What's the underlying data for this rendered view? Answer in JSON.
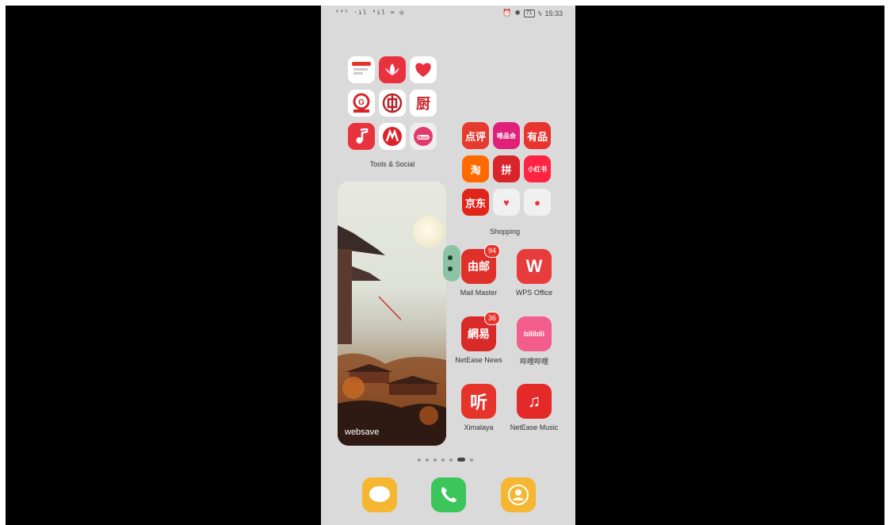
{
  "status": {
    "left_text": "⁰⁰ᴳ ·ıl ⁴ıl ≈ ◎",
    "battery": "71",
    "time": "15:33"
  },
  "folders": {
    "tools_social": {
      "label": "Tools & Social",
      "icons": [
        "notes-icon",
        "lotus-icon",
        "heart-app-icon",
        "bank-icon",
        "bank-of-china-icon",
        "kitchen-app-icon",
        "music-note-icon",
        "metro-icon",
        "music-player-icon"
      ]
    },
    "shopping": {
      "label": "Shopping",
      "icons": [
        {
          "name": "dianping-icon",
          "text": "点评"
        },
        {
          "name": "vip-shop-icon",
          "text": "唯品会"
        },
        {
          "name": "youpin-icon",
          "text": "有品"
        },
        {
          "name": "taobao-icon",
          "text": "淘"
        },
        {
          "name": "pinduoduo-icon",
          "text": "拼"
        },
        {
          "name": "xiaohongshu-icon",
          "text": "小红书"
        },
        {
          "name": "jd-icon",
          "text": "京东"
        },
        {
          "name": "heart-shop-icon",
          "text": "♥"
        },
        {
          "name": "pet-app-icon",
          "text": "●"
        }
      ]
    }
  },
  "widget": {
    "label": "websave"
  },
  "apps": [
    {
      "id": "mail-master",
      "label": "Mail Master",
      "glyph": "由邮",
      "badge": "94",
      "color": "#e0302a"
    },
    {
      "id": "wps-office",
      "label": "WPS Office",
      "glyph": "W",
      "badge": "",
      "color": "#e83b3b"
    },
    {
      "id": "netease-news",
      "label": "NetEase News",
      "glyph": "網易",
      "badge": "36",
      "color": "#d92a2a"
    },
    {
      "id": "bilibili",
      "label": "哔哩哔哩",
      "glyph": "bilibili",
      "badge": "",
      "color": "#f25d8e"
    },
    {
      "id": "ximalaya",
      "label": "Ximalaya",
      "glyph": "听",
      "badge": "",
      "color": "#e6332c"
    },
    {
      "id": "netease-music",
      "label": "NetEase Music",
      "glyph": "♫",
      "badge": "",
      "color": "#e42a28"
    }
  ],
  "pages": {
    "count": 7,
    "active": 5
  },
  "dock": [
    {
      "name": "messages-icon",
      "color": "#f5b731"
    },
    {
      "name": "phone-icon",
      "color": "#3bc55a"
    },
    {
      "name": "contacts-icon",
      "color": "#f5b731"
    }
  ]
}
